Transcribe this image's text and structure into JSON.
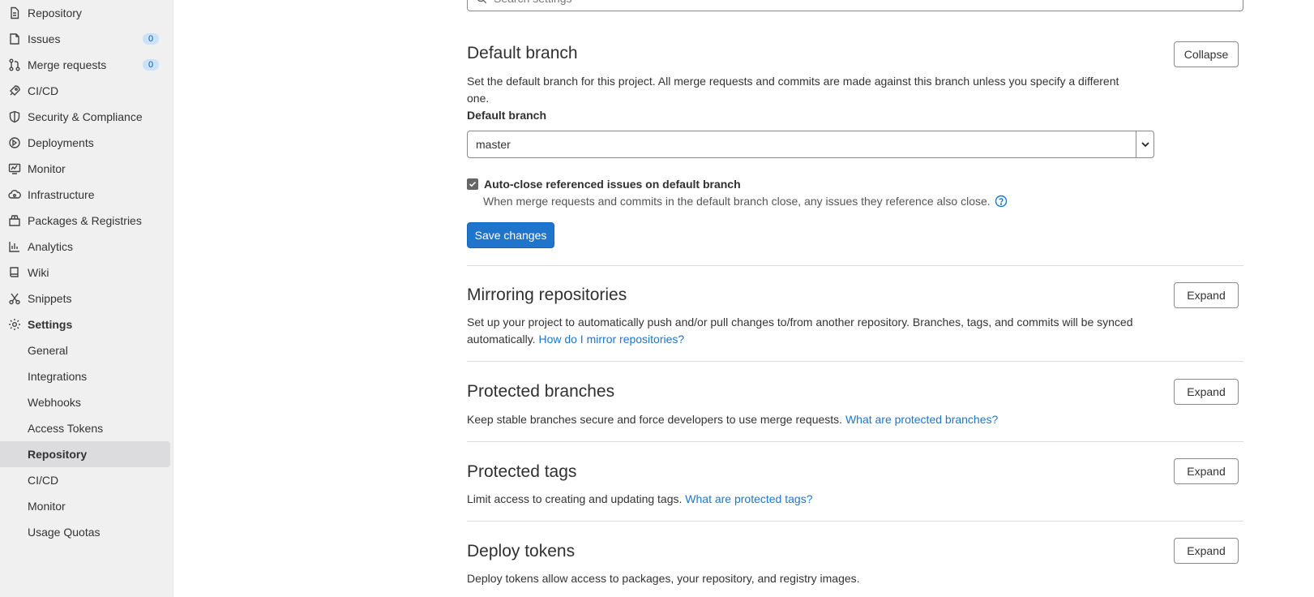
{
  "sidebar": {
    "items": [
      {
        "label": "Repository",
        "icon": "doc-icon"
      },
      {
        "label": "Issues",
        "icon": "issues-icon",
        "badge": "0"
      },
      {
        "label": "Merge requests",
        "icon": "merge-request-icon",
        "badge": "0"
      },
      {
        "label": "CI/CD",
        "icon": "rocket-icon"
      },
      {
        "label": "Security & Compliance",
        "icon": "shield-icon"
      },
      {
        "label": "Deployments",
        "icon": "deployments-icon"
      },
      {
        "label": "Monitor",
        "icon": "monitor-icon"
      },
      {
        "label": "Infrastructure",
        "icon": "cloud-icon"
      },
      {
        "label": "Packages & Registries",
        "icon": "package-icon"
      },
      {
        "label": "Analytics",
        "icon": "chart-icon"
      },
      {
        "label": "Wiki",
        "icon": "book-icon"
      },
      {
        "label": "Snippets",
        "icon": "scissors-icon"
      },
      {
        "label": "Settings",
        "icon": "gear-icon"
      }
    ],
    "settings_subitems": [
      {
        "label": "General"
      },
      {
        "label": "Integrations"
      },
      {
        "label": "Webhooks"
      },
      {
        "label": "Access Tokens"
      },
      {
        "label": "Repository",
        "active": true
      },
      {
        "label": "CI/CD"
      },
      {
        "label": "Monitor"
      },
      {
        "label": "Usage Quotas"
      }
    ]
  },
  "search": {
    "placeholder": "Search settings"
  },
  "default_branch": {
    "title": "Default branch",
    "button": "Collapse",
    "description": "Set the default branch for this project. All merge requests and commits are made against this branch unless you specify a different one.",
    "field_label": "Default branch",
    "selected": "master",
    "checkbox_label": "Auto-close referenced issues on default branch",
    "checkbox_checked": true,
    "checkbox_help": "When merge requests and commits in the default branch close, any issues they reference also close.",
    "save_label": "Save changes"
  },
  "mirroring": {
    "title": "Mirroring repositories",
    "button": "Expand",
    "description_line1": "Set up your project to automatically push and/or pull changes to/from another repository. Branches, tags, and commits will be synced",
    "description_line2": "automatically.",
    "link": "How do I mirror repositories?"
  },
  "protected_branches": {
    "title": "Protected branches",
    "button": "Expand",
    "description": "Keep stable branches secure and force developers to use merge requests.",
    "link": "What are protected branches?"
  },
  "protected_tags": {
    "title": "Protected tags",
    "button": "Expand",
    "description": "Limit access to creating and updating tags.",
    "link": "What are protected tags?"
  },
  "deploy_tokens": {
    "title": "Deploy tokens",
    "button": "Expand",
    "description": "Deploy tokens allow access to packages, your repository, and registry images."
  },
  "colors": {
    "primary": "#1f75cb",
    "badge_bg": "#cbe2f9",
    "sidebar_bg": "#f0f0f0"
  }
}
